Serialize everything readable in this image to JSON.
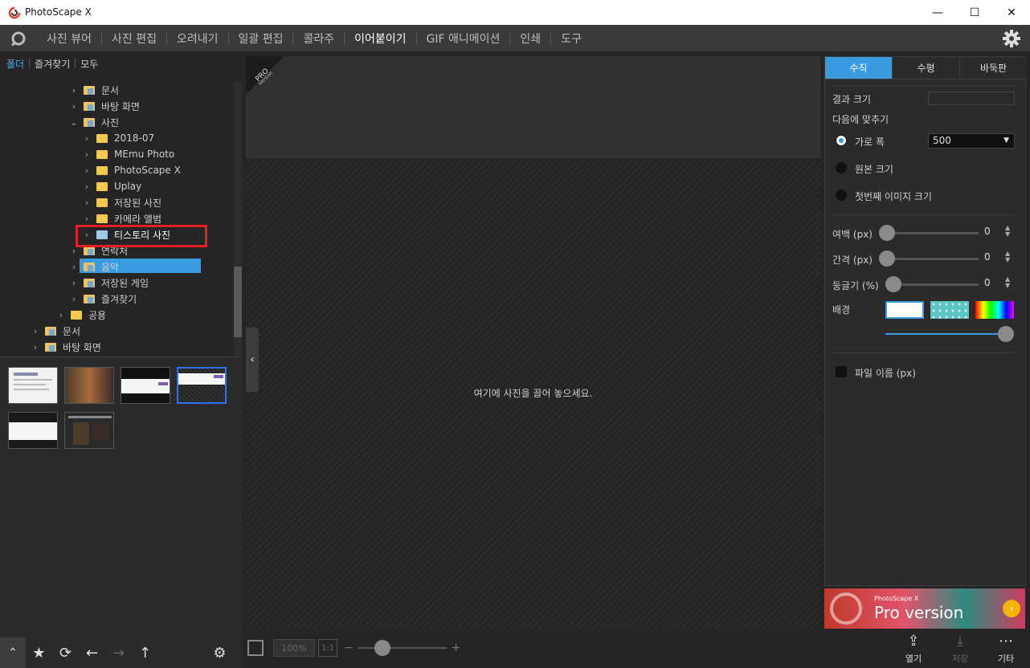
{
  "window": {
    "title": "PhotoScape X",
    "minimize": "—",
    "maximize": "☐",
    "close": "✕"
  },
  "menu": {
    "items": [
      "사진 뷰어",
      "사진 편집",
      "오려내기",
      "일괄 편집",
      "콜라주",
      "이어붙이기",
      "GIF 애니메이션",
      "인쇄",
      "도구"
    ],
    "active_index": 5
  },
  "left_tabs": {
    "folder": "폴더",
    "favorites": "즐겨찾기",
    "all": "모두"
  },
  "tree": [
    {
      "label": "문서",
      "chev": "›",
      "level": 1,
      "icon": "doc-folder"
    },
    {
      "label": "바탕 화면",
      "chev": "›",
      "level": 1,
      "icon": "doc-folder"
    },
    {
      "label": "사진",
      "chev": "⌄",
      "level": 1,
      "icon": "doc-folder"
    },
    {
      "label": "2018-07",
      "chev": "›",
      "level": 2,
      "icon": "folder"
    },
    {
      "label": "MEmu Photo",
      "chev": "›",
      "level": 2,
      "icon": "folder"
    },
    {
      "label": "PhotoScape X",
      "chev": "›",
      "level": 2,
      "icon": "folder"
    },
    {
      "label": "Uplay",
      "chev": "›",
      "level": 2,
      "icon": "folder"
    },
    {
      "label": "저장된 사진",
      "chev": "›",
      "level": 2,
      "icon": "folder"
    },
    {
      "label": "카메라 앨범",
      "chev": "›",
      "level": 2,
      "icon": "folder"
    },
    {
      "label": "티스토리 사진",
      "chev": "›",
      "level": 2,
      "icon": "folder",
      "selected": true
    },
    {
      "label": "연락처",
      "chev": "›",
      "level": 1,
      "icon": "doc-folder"
    },
    {
      "label": "음악",
      "chev": "›",
      "level": 1,
      "icon": "doc-folder"
    },
    {
      "label": "저장된 게임",
      "chev": "›",
      "level": 1,
      "icon": "doc-folder"
    },
    {
      "label": "즐겨찾기",
      "chev": "›",
      "level": 1,
      "icon": "doc-folder"
    },
    {
      "label": "공용",
      "chev": "›",
      "level": 0,
      "icon": "folder"
    },
    {
      "label": "문서",
      "chev": "›",
      "level": -1,
      "icon": "doc-folder"
    },
    {
      "label": "바탕 화면",
      "chev": "›",
      "level": -1,
      "icon": "doc-folder"
    }
  ],
  "thumbnails_count": 6,
  "center": {
    "drop_text": "여기에 사진을 끌어 놓으세요.",
    "pro_badge": "PRO Version",
    "collapse_icon": "‹"
  },
  "zoom": {
    "percent": "100%",
    "ratio": "1:1",
    "minus": "−",
    "plus": "+"
  },
  "right": {
    "tabs": [
      "수직",
      "수평",
      "바둑판"
    ],
    "active_tab": 0,
    "result_size_label": "결과 크기",
    "fit_label": "다음에 맞추기",
    "options": [
      "가로 폭",
      "원본 크기",
      "첫번째 이미지 크기"
    ],
    "width_value": "500",
    "margin_label": "여백 (px)",
    "margin_value": "0",
    "spacing_label": "간격 (px)",
    "spacing_value": "0",
    "round_label": "둥글기 (%)",
    "round_value": "0",
    "background_label": "배경",
    "filename_label": "파일 이름 (px)"
  },
  "ad": {
    "line1": "PhotoScape X",
    "line2": "Pro version"
  },
  "bottom_actions": {
    "open": "열기",
    "save": "저장",
    "more": "기타"
  },
  "colors": {
    "accent": "#3a9be0",
    "highlight_box": "#e51d24",
    "selected_thumb": "#2f6ff0"
  }
}
